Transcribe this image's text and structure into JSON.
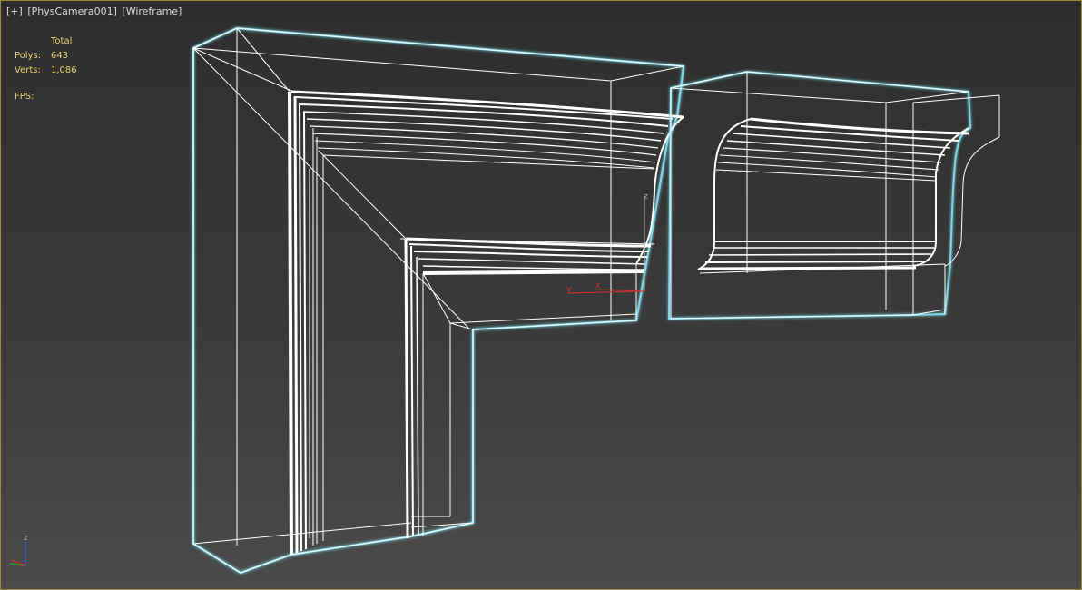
{
  "viewport": {
    "label": {
      "plus": "[+]",
      "camera": "[PhysCamera001]",
      "mode": "[Wireframe]"
    },
    "stats": {
      "header": "Total",
      "polys_label": "Polys:",
      "polys_value": "643",
      "verts_label": "Verts:",
      "verts_value": "1,086",
      "fps_label": "FPS:"
    },
    "pivot_gizmo": {
      "z": "z",
      "y": "y",
      "x": "x"
    },
    "axis_tripod": {
      "z": "z"
    }
  },
  "colors": {
    "background_top": "#2e2e2e",
    "background_bottom": "#4b4b4b",
    "wire": "#ffffff",
    "selection_glow": "#7fd8e8",
    "stats_text": "#e6d070",
    "viewport_border": "#9a8a3a"
  }
}
